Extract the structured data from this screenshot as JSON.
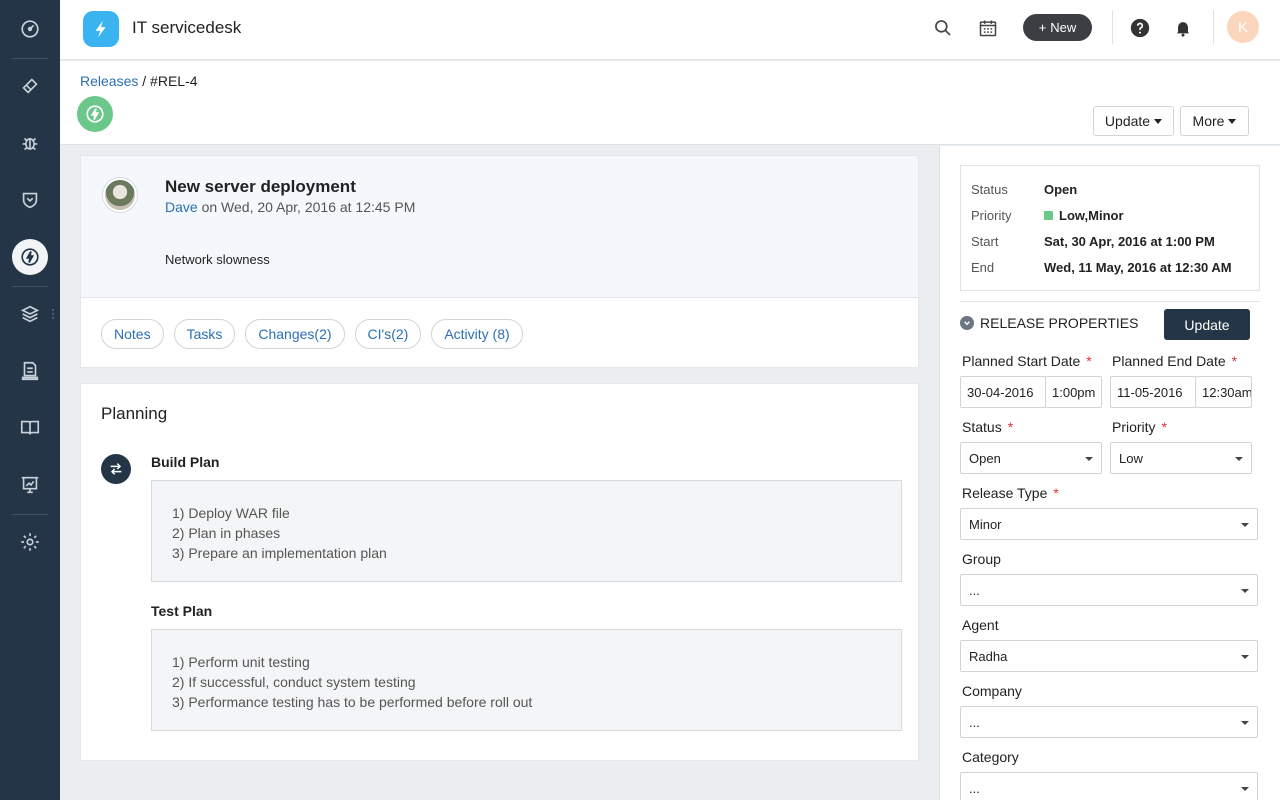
{
  "header": {
    "app_title": "IT servicedesk",
    "new_label": "New",
    "avatar_initial": "K"
  },
  "breadcrumb": {
    "parent": "Releases",
    "separator": "/",
    "current": "#REL-4"
  },
  "actions": {
    "update_label": "Update",
    "more_label": "More"
  },
  "ticket": {
    "title": "New server deployment",
    "author": "Dave",
    "meta": "on Wed, 20 Apr, 2016 at 12:45 PM",
    "description": "Network slowness"
  },
  "tabs": [
    "Notes",
    "Tasks",
    "Changes(2)",
    "CI's(2)",
    "Activity (8)"
  ],
  "planning": {
    "heading": "Planning",
    "build_plan": {
      "title": "Build Plan",
      "lines": [
        "1) Deploy WAR file",
        "2) Plan in phases",
        "3) Prepare an implementation plan"
      ]
    },
    "test_plan": {
      "title": "Test Plan",
      "lines": [
        "1) Perform unit testing",
        "2) If successful, conduct system testing",
        "3) Performance testing has to be performed before roll out"
      ]
    }
  },
  "summary": {
    "status_label": "Status",
    "status_value": "Open",
    "priority_label": "Priority",
    "priority_value": "Low,Minor",
    "start_label": "Start",
    "start_value": "Sat, 30 Apr, 2016 at 1:00 PM",
    "end_label": "End",
    "end_value": "Wed, 11 May, 2016 at 12:30 AM"
  },
  "properties": {
    "heading": "RELEASE PROPERTIES",
    "update_label": "Update",
    "planned_start_label": "Planned Start Date",
    "planned_start_date": "30-04-2016",
    "planned_start_time": "1:00pm",
    "planned_end_label": "Planned End Date",
    "planned_end_date": "11-05-2016",
    "planned_end_time": "12:30am",
    "status_label": "Status",
    "status_value": "Open",
    "priority_label": "Priority",
    "priority_value": "Low",
    "release_type_label": "Release Type",
    "release_type_value": "Minor",
    "group_label": "Group",
    "group_value": "...",
    "agent_label": "Agent",
    "agent_value": "Radha",
    "company_label": "Company",
    "company_value": "...",
    "category_label": "Category",
    "category_value": "...",
    "required_marker": "*"
  },
  "colors": {
    "sidebar_bg": "#243547",
    "link": "#2c6fb3",
    "logo": "#3ab3f1",
    "release_badge": "#6cc78a",
    "required": "#e0313a"
  }
}
